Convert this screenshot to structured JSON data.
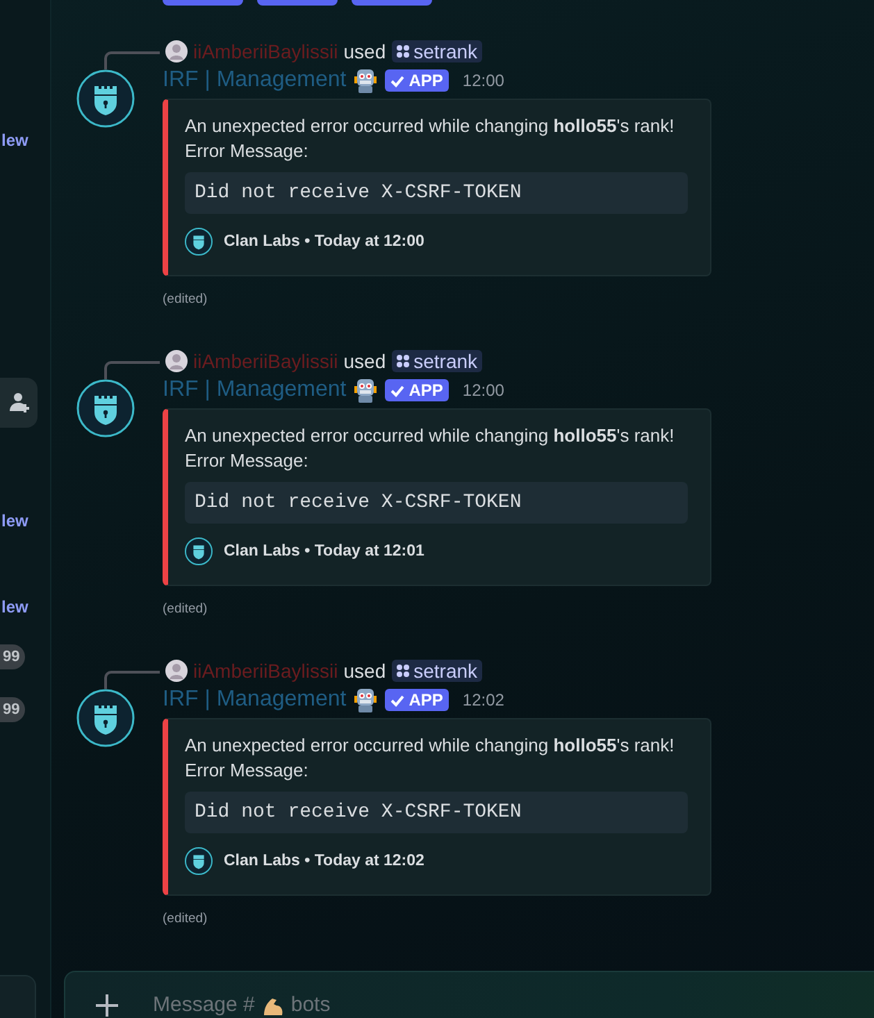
{
  "sidebar": {
    "items": [
      {
        "kind": "link",
        "text": "lew"
      },
      {
        "kind": "icon-button"
      },
      {
        "kind": "link",
        "text": "lew"
      },
      {
        "kind": "link",
        "text": "lew"
      },
      {
        "kind": "badge",
        "text": "99"
      },
      {
        "kind": "badge",
        "text": "99"
      }
    ]
  },
  "messages": [
    {
      "user": "iiAmberiiBaylissii",
      "action": "used",
      "command": "setrank",
      "author": "IRF | Management",
      "badge": "APP",
      "time": "12:00",
      "embed": {
        "description": "An unexpected error occurred while changing **hollo55**'s rank!",
        "label": "Error Message:",
        "code": "Did not receive X-CSRF-TOKEN",
        "footer": "Clan Labs • Today at 12:00"
      },
      "edited": "(edited)"
    },
    {
      "user": "iiAmberiiBaylissii",
      "action": "used",
      "command": "setrank",
      "author": "IRF | Management",
      "badge": "APP",
      "time": "12:00",
      "embed": {
        "description": "An unexpected error occurred while changing **hollo55**'s rank!",
        "label": "Error Message:",
        "code": "Did not receive X-CSRF-TOKEN",
        "footer": "Clan Labs • Today at 12:01"
      },
      "edited": "(edited)"
    },
    {
      "user": "iiAmberiiBaylissii",
      "action": "used",
      "command": "setrank",
      "author": "IRF | Management",
      "badge": "APP",
      "time": "12:02",
      "embed": {
        "description": "An unexpected error occurred while changing **hollo55**'s rank!",
        "label": "Error Message:",
        "code": "Did not receive X-CSRF-TOKEN",
        "footer": "Clan Labs • Today at 12:02"
      },
      "edited": "(edited)"
    }
  ],
  "composer": {
    "prompt": "Message #",
    "channel": "bots"
  }
}
